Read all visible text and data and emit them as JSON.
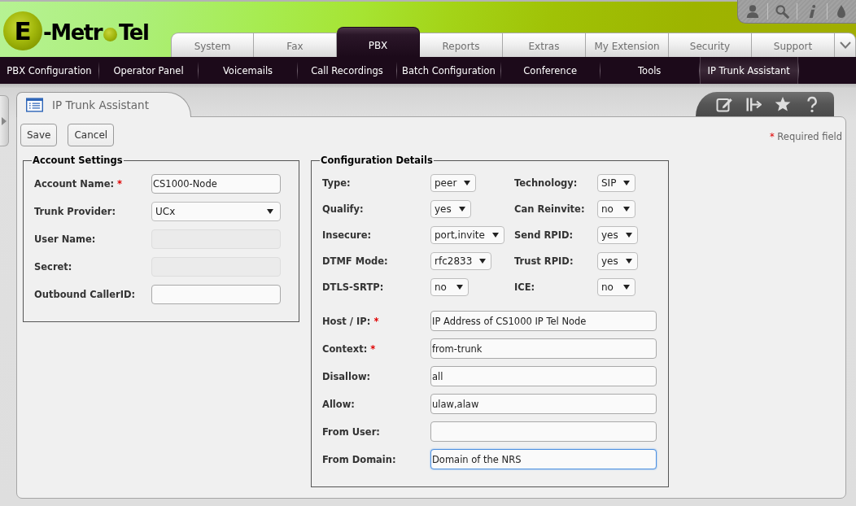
{
  "header": {
    "logo": {
      "badge_letter": "E",
      "wordmark_start": "-Metr",
      "wordmark_end": "Tel"
    },
    "main_tabs": [
      {
        "label": "System",
        "selected": false
      },
      {
        "label": "Fax",
        "selected": false
      },
      {
        "label": "PBX",
        "selected": true
      },
      {
        "label": "Reports",
        "selected": false
      },
      {
        "label": "Extras",
        "selected": false
      },
      {
        "label": "My Extension",
        "selected": false
      },
      {
        "label": "Security",
        "selected": false
      },
      {
        "label": "Support",
        "selected": false
      }
    ]
  },
  "sub_menu": [
    {
      "label": "PBX Configuration",
      "selected": false
    },
    {
      "label": "Operator Panel",
      "selected": false
    },
    {
      "label": "Voicemails",
      "selected": false
    },
    {
      "label": "Call Recordings",
      "selected": false
    },
    {
      "label": "Batch Configuration",
      "selected": false
    },
    {
      "label": "Conference",
      "selected": false
    },
    {
      "label": "Tools",
      "selected": false
    },
    {
      "label": "IP Trunk Assistant",
      "selected": true
    }
  ],
  "page": {
    "title": "IP Trunk Assistant",
    "buttons": [
      "Save",
      "Cancel"
    ],
    "required_note": {
      "mark": "*",
      "text": "Required field"
    },
    "account_settings": {
      "legend": "Account Settings",
      "fields": [
        {
          "label": "Account Name:",
          "required_mark": "*",
          "kind": "text",
          "value": "CS1000-Node",
          "disabled": false
        },
        {
          "label": "Trunk Provider:",
          "kind": "select",
          "value": "UCx",
          "disabled": false
        },
        {
          "label": "User Name:",
          "kind": "text",
          "disabled": true
        },
        {
          "label": "Secret:",
          "kind": "text",
          "disabled": true
        },
        {
          "label": "Outbound CallerID:",
          "kind": "text",
          "disabled": false
        }
      ]
    },
    "configuration_details": {
      "legend": "Configuration Details",
      "selects": [
        {
          "label": "Type:",
          "value": "peer"
        },
        {
          "label": "Technology:",
          "value": "SIP"
        },
        {
          "label": "Qualify:",
          "value": "yes"
        },
        {
          "label": "Can Reinvite:",
          "value": "no"
        },
        {
          "label": "Insecure:",
          "value": "port,invite"
        },
        {
          "label": "Send RPID:",
          "value": "yes"
        },
        {
          "label": "DTMF Mode:",
          "value": "rfc2833"
        },
        {
          "label": "Trust RPID:",
          "value": "yes"
        },
        {
          "label": "DTLS-SRTP:",
          "value": "no"
        },
        {
          "label": "ICE:",
          "value": "no"
        }
      ],
      "text_fields": [
        {
          "label": "Host / IP:",
          "required_mark": "*",
          "value": "IP Address of CS1000 IP Tel Node",
          "focused": false
        },
        {
          "label": "Context:",
          "required_mark": "*",
          "value": "from-trunk",
          "focused": false
        },
        {
          "label": "Disallow:",
          "value": "all",
          "focused": false
        },
        {
          "label": "Allow:",
          "value": "ulaw,alaw",
          "focused": false
        },
        {
          "label": "From User:",
          "focused": false
        },
        {
          "label": "From Domain:",
          "value": "Domain of the NRS",
          "focused": true
        }
      ]
    }
  }
}
